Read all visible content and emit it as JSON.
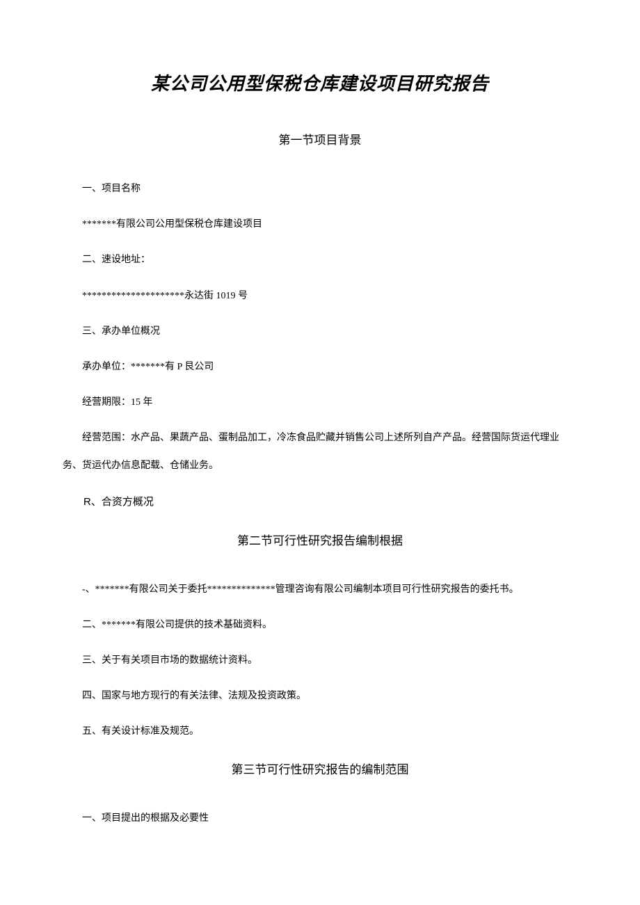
{
  "title": "某公司公用型保税仓库建设项目研究报告",
  "section1": {
    "header": "第一节项目背景",
    "p1": "一、项目名称",
    "p2": "*******有限公司公用型保税仓库建设项目",
    "p3": "二、速设地址：",
    "p4": "*********************永达街 1019 号",
    "p5": "三、承办单位概况",
    "p6": "承办单位：*******有 P 艮公司",
    "p7": "经营期限：15 年",
    "p8": "经营范围：水产品、果蔬产品、蛋制品加工，冷冻食品贮藏并销售公司上述所列自产产品。经营国际货运代理业务、货运代办信息配载、仓储业务。",
    "p9": "R、合资方概况"
  },
  "section2": {
    "header": "第二节可行性研究报告编制根据",
    "p1": "-、*******有限公司关于委托**************管理咨询有限公司编制本项目可行性研究报告的委托书。",
    "p2": "二、*******有限公司提供的技术基础资料。",
    "p3": "三、关于有关项目市场的数据统计资料。",
    "p4": "四、国家与地方现行的有关法律、法规及投资政策。",
    "p5": "五、有关设计标准及规范。"
  },
  "section3": {
    "header": "第三节可行性研究报告的编制范围",
    "p1": "一、项目提出的根据及必要性"
  }
}
